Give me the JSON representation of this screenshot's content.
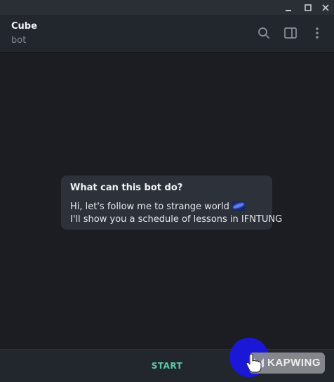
{
  "window": {
    "minimize_icon": "minimize-icon",
    "maximize_icon": "maximize-icon",
    "close_icon": "close-icon"
  },
  "header": {
    "title": "Cube",
    "status": "bot",
    "icons": [
      "search-icon",
      "sidebar-toggle-icon",
      "more-vert-icon"
    ]
  },
  "intro": {
    "title": "What can this bot do?",
    "line1": "Hi, let's follow me to strange world",
    "line1_emoji": "galaxy-emoji",
    "line2": "I'll show you a schedule of lessons in IFNTUNG"
  },
  "footer": {
    "start_label": "START",
    "accent_color": "#5dc8a8"
  },
  "watermark": {
    "text": "KAPWING"
  },
  "colors": {
    "background": "#1b1d23",
    "header": "#22262d",
    "card": "#2d3139",
    "cursor_highlight": "#1b17d6"
  }
}
